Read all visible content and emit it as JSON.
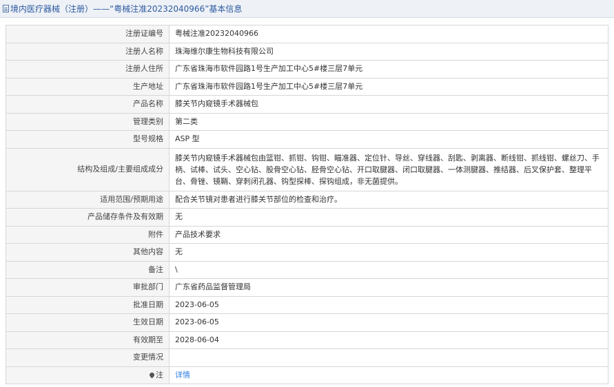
{
  "header": {
    "title": "境内医疗器械（注册）——“粤械注准20232040966”基本信息",
    "icon": "document-icon"
  },
  "rows": [
    {
      "label": "注册证编号",
      "value": "粤械注准20232040966"
    },
    {
      "label": "注册人名称",
      "value": "珠海维尔康生物科技有限公司"
    },
    {
      "label": "注册人住所",
      "value": "广东省珠海市软件园路1号生产加工中心5#楼三层7单元"
    },
    {
      "label": "生产地址",
      "value": "广东省珠海市软件园路1号生产加工中心5#楼三层7单元"
    },
    {
      "label": "产品名称",
      "value": "膝关节内窥镜手术器械包"
    },
    {
      "label": "管理类别",
      "value": "第二类"
    },
    {
      "label": "型号规格",
      "value": "ASP 型"
    },
    {
      "label": "结构及组成/主要组成成分",
      "value": "膝关节内窥镜手术器械包由篮钳、抓钳、钩钳、瞄准器、定位针、导丝、穿线器、刮匙、剥离器、断线钳、抓线钳、螺丝刀、手柄、试棒、试头、空心钻、股骨空心钻、胫骨空心钻、开口取腱器、闭口取腱器、一体测腱器、推结器、后叉保护套、整理平台、骨锉、镜鞘、穿刺闭孔器、钩型探棒、探钩组成，非无菌提供。"
    },
    {
      "label": "适用范围/预期用途",
      "value": "配合关节镜对患者进行膝关节部位的检查和治疗。"
    },
    {
      "label": "产品储存条件及有效期",
      "value": "无"
    },
    {
      "label": "附件",
      "value": "产品技术要求"
    },
    {
      "label": "其他内容",
      "value": "无"
    },
    {
      "label": "备注",
      "value": "\\"
    },
    {
      "label": "审批部门",
      "value": "广东省药品监督管理局"
    },
    {
      "label": "批准日期",
      "value": "2023-06-05"
    },
    {
      "label": "生效日期",
      "value": "2023-06-05"
    },
    {
      "label": "有效期至",
      "value": "2028-06-04"
    },
    {
      "label": "变更情况",
      "value": ""
    }
  ],
  "note": {
    "label": "注",
    "icon": "pin-icon",
    "link_text": "详情"
  }
}
